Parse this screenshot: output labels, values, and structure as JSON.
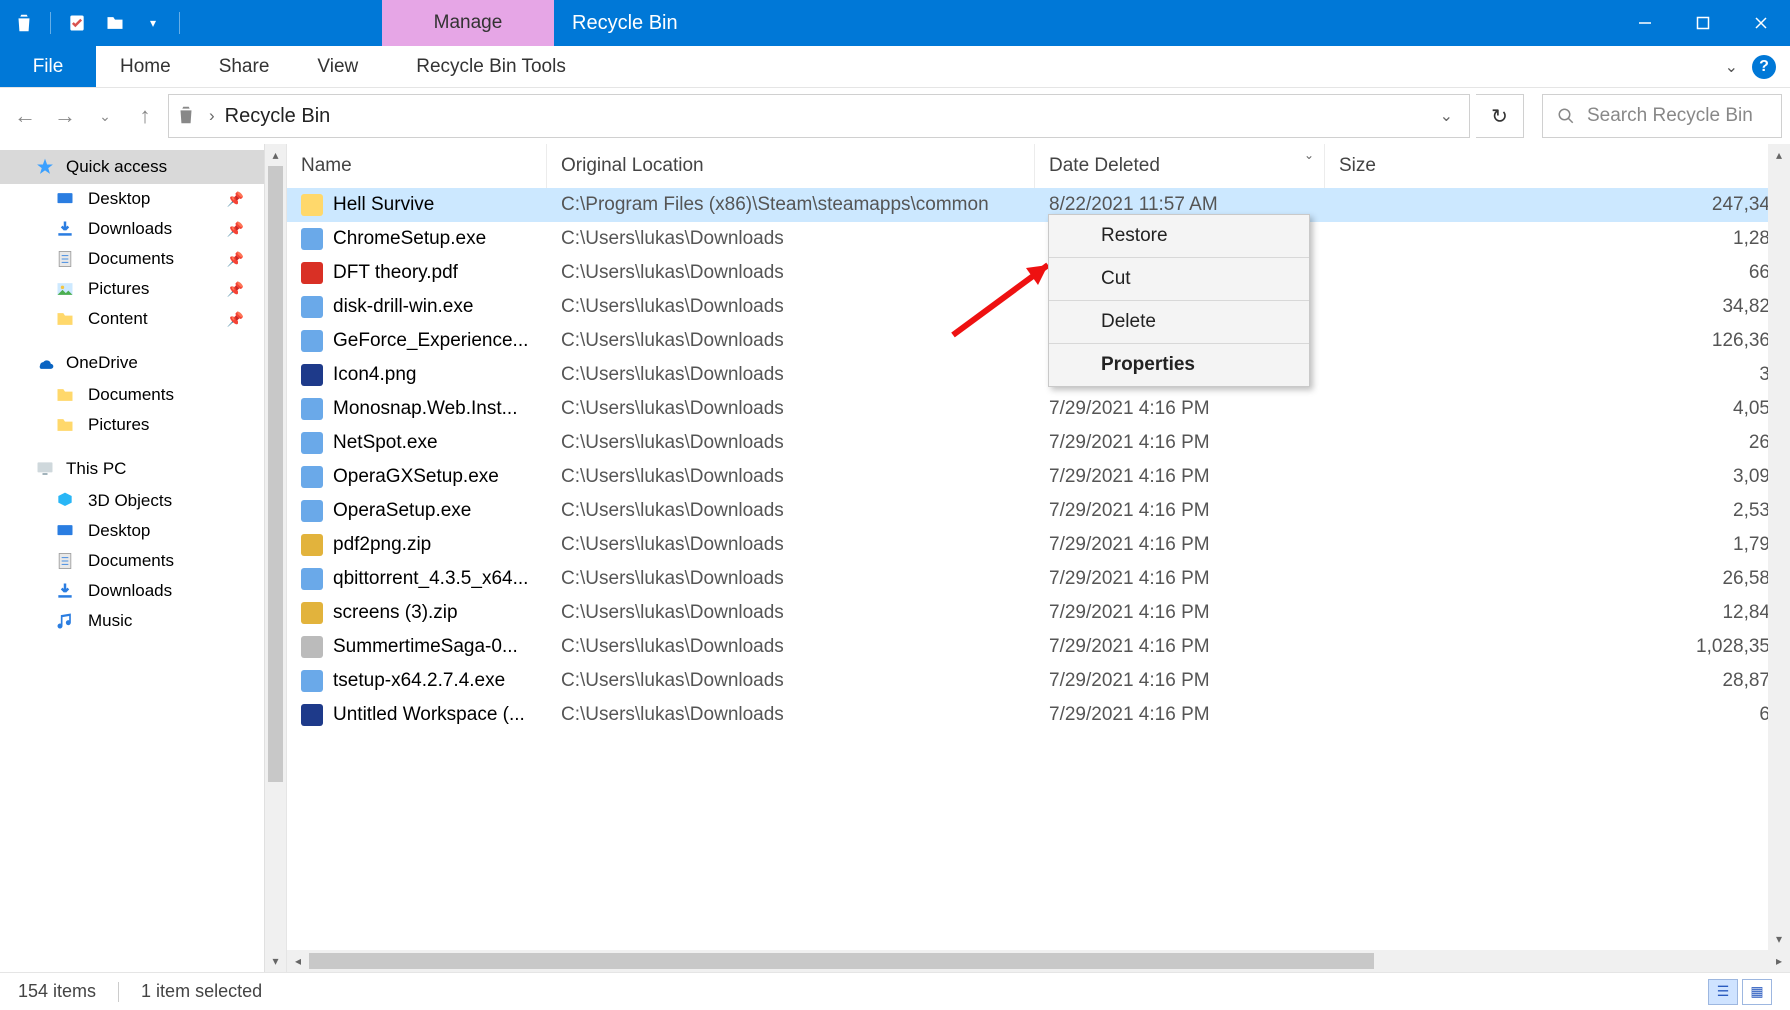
{
  "window": {
    "title": "Recycle Bin",
    "manage_label": "Manage"
  },
  "ribbon": {
    "file": "File",
    "tabs": [
      "Home",
      "Share",
      "View"
    ],
    "contextual": "Recycle Bin Tools"
  },
  "addressbar": {
    "location": "Recycle Bin"
  },
  "search": {
    "placeholder": "Search Recycle Bin"
  },
  "nav": {
    "quick_access": "Quick access",
    "qa_items": [
      {
        "label": "Desktop",
        "icon": "desktop",
        "pinned": true
      },
      {
        "label": "Downloads",
        "icon": "downloads",
        "pinned": true
      },
      {
        "label": "Documents",
        "icon": "documents",
        "pinned": true
      },
      {
        "label": "Pictures",
        "icon": "pictures",
        "pinned": true
      },
      {
        "label": "Content",
        "icon": "folder",
        "pinned": true
      }
    ],
    "onedrive": "OneDrive",
    "od_items": [
      {
        "label": "Documents",
        "icon": "folder"
      },
      {
        "label": "Pictures",
        "icon": "folder"
      }
    ],
    "this_pc": "This PC",
    "pc_items": [
      {
        "label": "3D Objects",
        "icon": "3d"
      },
      {
        "label": "Desktop",
        "icon": "desktop"
      },
      {
        "label": "Documents",
        "icon": "documents"
      },
      {
        "label": "Downloads",
        "icon": "downloads"
      },
      {
        "label": "Music",
        "icon": "music"
      }
    ]
  },
  "columns": {
    "name": "Name",
    "location": "Original Location",
    "date": "Date Deleted",
    "size": "Size"
  },
  "rows": [
    {
      "name": "Hell Survive",
      "icon": "folder",
      "location": "C:\\Program Files (x86)\\Steam\\steamapps\\common",
      "date": "8/22/2021 11:57 AM",
      "size": "247,34",
      "selected": true
    },
    {
      "name": "ChromeSetup.exe",
      "icon": "exe",
      "location": "C:\\Users\\lukas\\Downloads",
      "date": "",
      "size": "1,28"
    },
    {
      "name": "DFT theory.pdf",
      "icon": "pdf",
      "location": "C:\\Users\\lukas\\Downloads",
      "date": "",
      "size": "66"
    },
    {
      "name": "disk-drill-win.exe",
      "icon": "exe",
      "location": "C:\\Users\\lukas\\Downloads",
      "date": "",
      "size": "34,82"
    },
    {
      "name": "GeForce_Experience...",
      "icon": "exe",
      "location": "C:\\Users\\lukas\\Downloads",
      "date": "",
      "size": "126,36"
    },
    {
      "name": "Icon4.png",
      "icon": "img",
      "location": "C:\\Users\\lukas\\Downloads",
      "date": "",
      "size": "3"
    },
    {
      "name": "Monosnap.Web.Inst...",
      "icon": "exe",
      "location": "C:\\Users\\lukas\\Downloads",
      "date": "7/29/2021 4:16 PM",
      "size": "4,05"
    },
    {
      "name": "NetSpot.exe",
      "icon": "exe",
      "location": "C:\\Users\\lukas\\Downloads",
      "date": "7/29/2021 4:16 PM",
      "size": "26"
    },
    {
      "name": "OperaGXSetup.exe",
      "icon": "exe",
      "location": "C:\\Users\\lukas\\Downloads",
      "date": "7/29/2021 4:16 PM",
      "size": "3,09"
    },
    {
      "name": "OperaSetup.exe",
      "icon": "exe",
      "location": "C:\\Users\\lukas\\Downloads",
      "date": "7/29/2021 4:16 PM",
      "size": "2,53"
    },
    {
      "name": "pdf2png.zip",
      "icon": "zip",
      "location": "C:\\Users\\lukas\\Downloads",
      "date": "7/29/2021 4:16 PM",
      "size": "1,79"
    },
    {
      "name": "qbittorrent_4.3.5_x64...",
      "icon": "exe",
      "location": "C:\\Users\\lukas\\Downloads",
      "date": "7/29/2021 4:16 PM",
      "size": "26,58"
    },
    {
      "name": "screens (3).zip",
      "icon": "zip",
      "location": "C:\\Users\\lukas\\Downloads",
      "date": "7/29/2021 4:16 PM",
      "size": "12,84"
    },
    {
      "name": "SummertimeSaga-0...",
      "icon": "doc",
      "location": "C:\\Users\\lukas\\Downloads",
      "date": "7/29/2021 4:16 PM",
      "size": "1,028,35"
    },
    {
      "name": "tsetup-x64.2.7.4.exe",
      "icon": "exe",
      "location": "C:\\Users\\lukas\\Downloads",
      "date": "7/29/2021 4:16 PM",
      "size": "28,87"
    },
    {
      "name": "Untitled Workspace (...",
      "icon": "img",
      "location": "C:\\Users\\lukas\\Downloads",
      "date": "7/29/2021 4:16 PM",
      "size": "6"
    }
  ],
  "context_menu": [
    "Restore",
    "Cut",
    "Delete",
    "Properties"
  ],
  "status": {
    "items": "154 items",
    "selection": "1 item selected"
  }
}
